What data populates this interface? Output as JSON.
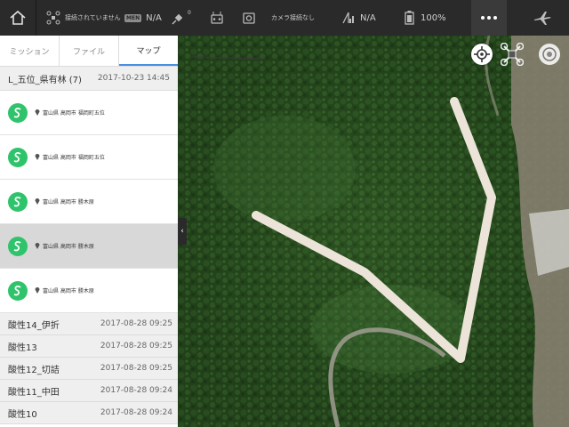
{
  "topbar": {
    "home_icon": "home-icon",
    "aircraft_status": "接続されていません",
    "mode_badge": "MEN",
    "mode_value": "N/A",
    "gps_count": "0",
    "camera_status": "カメラ接続なし",
    "signal_value": "N/A",
    "battery_value": "100%",
    "more_icon": "more-icon",
    "plane_icon": "airplane-icon"
  },
  "tabs": [
    {
      "label": "ミッション",
      "active": false
    },
    {
      "label": "ファイル",
      "active": false
    },
    {
      "label": "マップ",
      "active": true
    }
  ],
  "group": {
    "name": "L_五位_県有林 (7)",
    "date": "2017-10-23 14:45"
  },
  "missions": [
    {
      "location": "富山県 高岡市 福岡町五位",
      "selected": false
    },
    {
      "location": "富山県 高岡市 福岡町五位",
      "selected": false
    },
    {
      "location": "富山県 高岡市 勝木原",
      "selected": false
    },
    {
      "location": "富山県 高岡市 勝木原",
      "selected": true
    },
    {
      "location": "富山県 高岡市 勝木原",
      "selected": false
    }
  ],
  "rows": [
    {
      "name": "酸性14_伊折",
      "date": "2017-08-28 09:25"
    },
    {
      "name": "酸性13",
      "date": "2017-08-28 09:25"
    },
    {
      "name": "酸性12_切詰",
      "date": "2017-08-28 09:25"
    },
    {
      "name": "酸性11_中田",
      "date": "2017-08-28 09:24"
    },
    {
      "name": "酸性10",
      "date": "2017-08-28 09:24"
    }
  ],
  "map": {
    "collapse_arrow": "‹",
    "flight_path_color": "#ece4d8"
  },
  "colors": {
    "topbar": "#2a2a2a",
    "accent": "#4a90e2",
    "mission_logo": "#2fc46b"
  }
}
